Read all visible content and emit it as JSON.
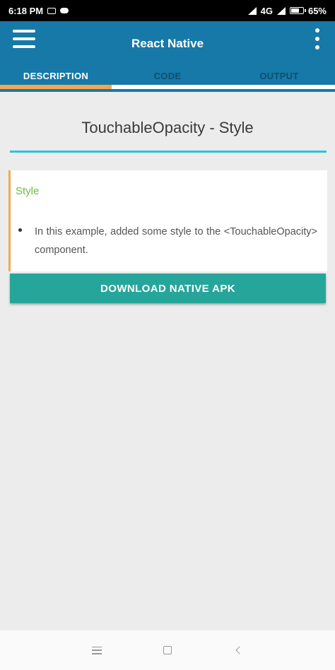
{
  "status_bar": {
    "time": "6:18 PM",
    "network": "4G",
    "battery": "65%"
  },
  "app_bar": {
    "title": "React Native"
  },
  "tabs": [
    {
      "label": "DESCRIPTION",
      "active": true
    },
    {
      "label": "CODE",
      "active": false
    },
    {
      "label": "OUTPUT",
      "active": false
    }
  ],
  "page": {
    "heading": "TouchableOpacity - Style"
  },
  "card": {
    "title": "Style",
    "items": [
      "In this example, added some style to the <TouchableOpacity> component."
    ]
  },
  "download_button": {
    "label": "DOWNLOAD NATIVE APK"
  },
  "colors": {
    "app_bar": "#1679a8",
    "tab_indicator": "#f5a74c",
    "heading_rule": "#26c6da",
    "card_title": "#6cbf3a",
    "button": "#26a69a"
  },
  "icons": {
    "menu": "hamburger-menu-icon",
    "more": "more-vertical-icon",
    "nav_recents": "recents-icon",
    "nav_home": "home-icon",
    "nav_back": "back-icon"
  }
}
